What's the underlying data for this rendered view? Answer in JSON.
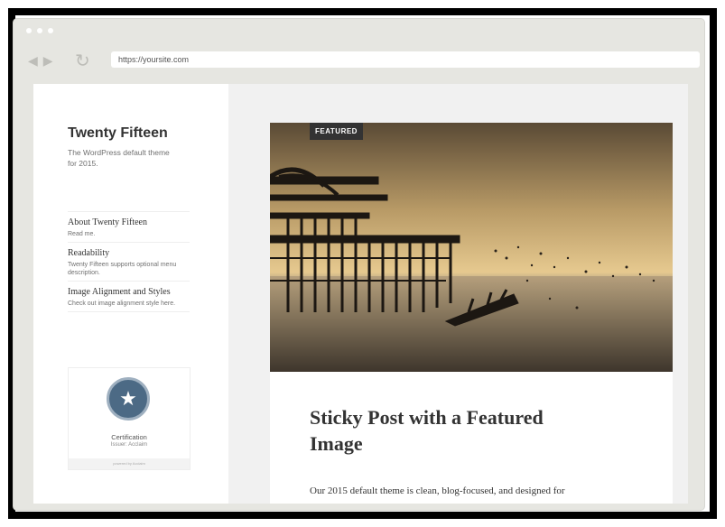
{
  "browser": {
    "url": "https://yoursite.com"
  },
  "sidebar": {
    "site_title": "Twenty Fifteen",
    "site_description": "The WordPress default theme for 2015.",
    "menu": [
      {
        "title": "About Twenty Fifteen",
        "desc": "Read me."
      },
      {
        "title": "Readability",
        "desc": "Twenty Fifteen supports optional menu description."
      },
      {
        "title": "Image Alignment and Styles",
        "desc": "Check out image alignment style here."
      }
    ],
    "widget": {
      "badge_title": "Certification",
      "badge_issuer": "Issuer: Acclaim",
      "footer": "powered by Acclaim"
    }
  },
  "post": {
    "tag": "FEATURED",
    "title": "Sticky Post with a Featured Image",
    "excerpt": "Our 2015 default theme is clean, blog-focused, and designed for"
  },
  "colors": {
    "browser_chrome": "#e6e6e1",
    "content_bg": "#f1f1f1",
    "tag_bg": "#333333",
    "badge_blue": "#4c6a85"
  }
}
